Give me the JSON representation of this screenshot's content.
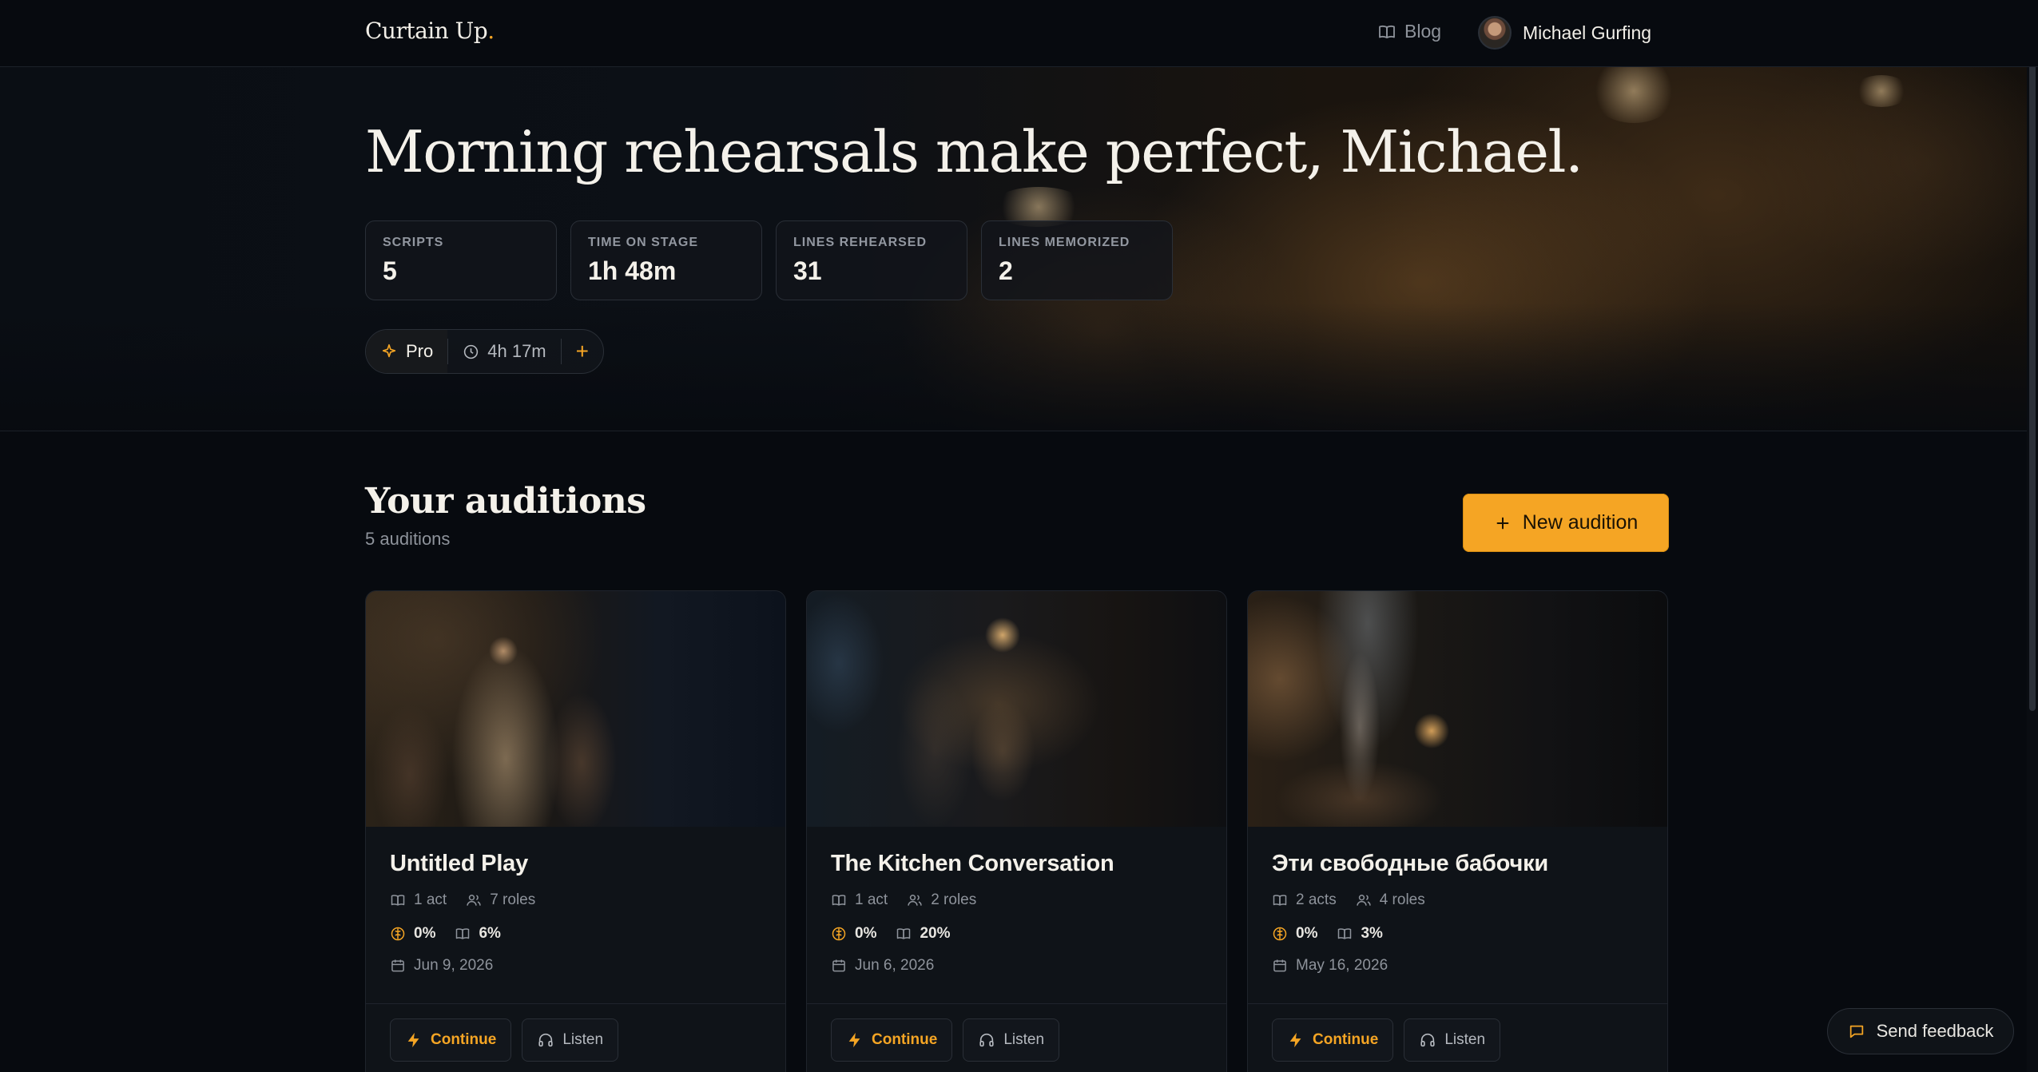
{
  "nav": {
    "brand": "Curtain Up",
    "brand_dot": ".",
    "blog_label": "Blog",
    "user_name": "Michael Gurfing"
  },
  "hero": {
    "greeting": "Morning rehearsals make perfect, Michael.",
    "stats": [
      {
        "label": "SCRIPTS",
        "value": "5"
      },
      {
        "label": "TIME ON STAGE",
        "value": "1h 48m"
      },
      {
        "label": "LINES REHEARSED",
        "value": "31"
      },
      {
        "label": "LINES MEMORIZED",
        "value": "2"
      }
    ],
    "plan": {
      "name": "Pro",
      "time_left": "4h 17m",
      "add": "+"
    }
  },
  "auditions": {
    "title": "Your auditions",
    "count_label": "5 auditions",
    "new_button": "New audition",
    "cards": [
      {
        "title": "Untitled Play",
        "acts": "1 act",
        "roles": "7 roles",
        "memorized": "0%",
        "rehearsed": "6%",
        "date": "Jun 9, 2026",
        "continue": "Continue",
        "listen": "Listen"
      },
      {
        "title": "The Kitchen Conversation",
        "acts": "1 act",
        "roles": "2 roles",
        "memorized": "0%",
        "rehearsed": "20%",
        "date": "Jun 6, 2026",
        "continue": "Continue",
        "listen": "Listen"
      },
      {
        "title": "Эти свободные бабочки",
        "acts": "2 acts",
        "roles": "4 roles",
        "memorized": "0%",
        "rehearsed": "3%",
        "date": "May 16, 2026",
        "continue": "Continue",
        "listen": "Listen"
      }
    ]
  },
  "feedback_label": "Send feedback",
  "colors": {
    "accent": "#f5a524",
    "background": "#070a0f",
    "card": "#0f1318",
    "border": "#2a2f37"
  }
}
